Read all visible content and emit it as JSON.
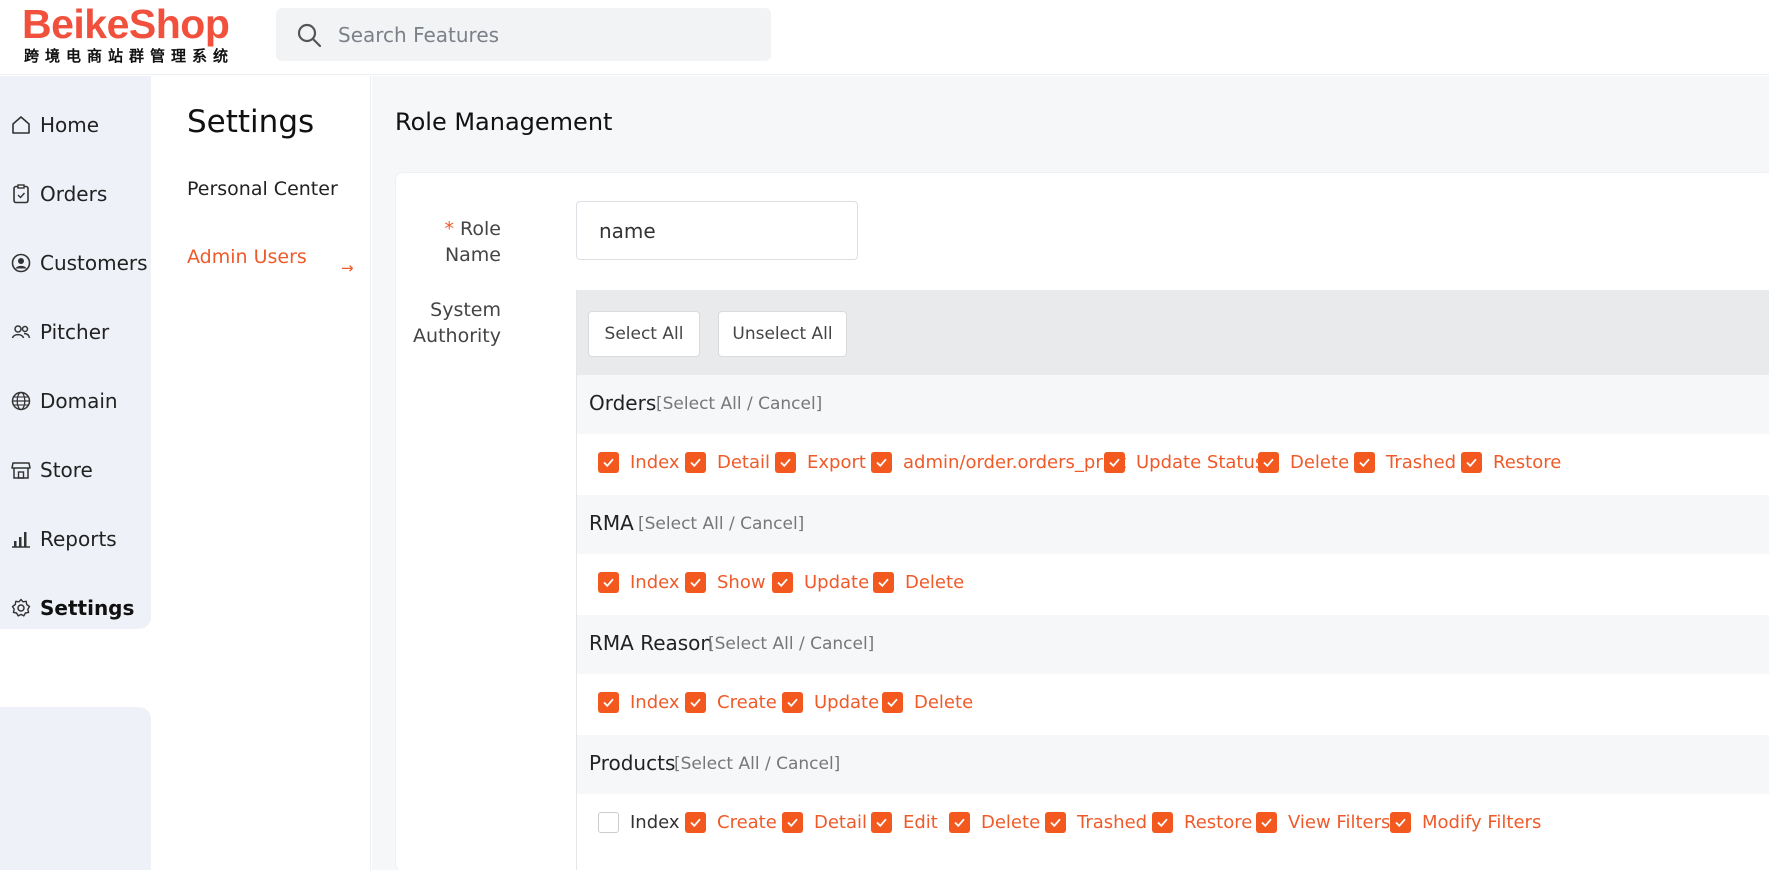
{
  "brand": {
    "name": "BeikeShop",
    "tagline": "跨境电商站群管理系统",
    "color": "#f1503c"
  },
  "search": {
    "placeholder": "Search Features",
    "value": ""
  },
  "nav": {
    "items": [
      {
        "label": "Home",
        "icon": "home-icon",
        "active": false
      },
      {
        "label": "Orders",
        "icon": "clipboard-icon",
        "active": false
      },
      {
        "label": "Customers",
        "icon": "user-circle-icon",
        "active": false
      },
      {
        "label": "Pitcher",
        "icon": "users-icon",
        "active": false
      },
      {
        "label": "Domain",
        "icon": "globe-icon",
        "active": false
      },
      {
        "label": "Store",
        "icon": "store-icon",
        "active": false
      },
      {
        "label": "Reports",
        "icon": "bar-chart-icon",
        "active": false
      },
      {
        "label": "Settings",
        "icon": "gear-icon",
        "active": true
      }
    ]
  },
  "subnav": {
    "title": "Settings",
    "items": [
      {
        "label": "Personal Center",
        "active": false
      },
      {
        "label": "Admin Users",
        "active": true
      }
    ]
  },
  "main": {
    "title": "Role Management",
    "role_name": {
      "label": "Role Name",
      "required_mark": "*",
      "value": "name"
    },
    "authority": {
      "label_line1": "System",
      "label_line2": "Authority",
      "select_all": "Select All",
      "unselect_all": "Unselect All",
      "group_control": "[Select All / Cancel]",
      "groups": [
        {
          "name": "Orders",
          "perms": [
            {
              "label": "Index",
              "checked": true
            },
            {
              "label": "Detail",
              "checked": true
            },
            {
              "label": "Export",
              "checked": true
            },
            {
              "label": "admin/order.orders_print",
              "checked": true
            },
            {
              "label": "Update Status",
              "checked": true
            },
            {
              "label": "Delete",
              "checked": true
            },
            {
              "label": "Trashed",
              "checked": true
            },
            {
              "label": "Restore",
              "checked": true
            }
          ]
        },
        {
          "name": "RMA",
          "perms": [
            {
              "label": "Index",
              "checked": true
            },
            {
              "label": "Show",
              "checked": true
            },
            {
              "label": "Update",
              "checked": true
            },
            {
              "label": "Delete",
              "checked": true
            }
          ]
        },
        {
          "name": "RMA Reason",
          "perms": [
            {
              "label": "Index",
              "checked": true
            },
            {
              "label": "Create",
              "checked": true
            },
            {
              "label": "Update",
              "checked": true
            },
            {
              "label": "Delete",
              "checked": true
            }
          ]
        },
        {
          "name": "Products",
          "perms": [
            {
              "label": "Index",
              "checked": false
            },
            {
              "label": "Create",
              "checked": true
            },
            {
              "label": "Detail",
              "checked": true
            },
            {
              "label": "Edit",
              "checked": true
            },
            {
              "label": "Delete",
              "checked": true
            },
            {
              "label": "Trashed",
              "checked": true
            },
            {
              "label": "Restore",
              "checked": true
            },
            {
              "label": "View Filters",
              "checked": true
            },
            {
              "label": "Modify Filters",
              "checked": true
            }
          ]
        }
      ]
    }
  },
  "colors": {
    "accent": "#ef5a2a",
    "checkbox": "#f3591f",
    "nav_bg": "#eef1f7"
  }
}
